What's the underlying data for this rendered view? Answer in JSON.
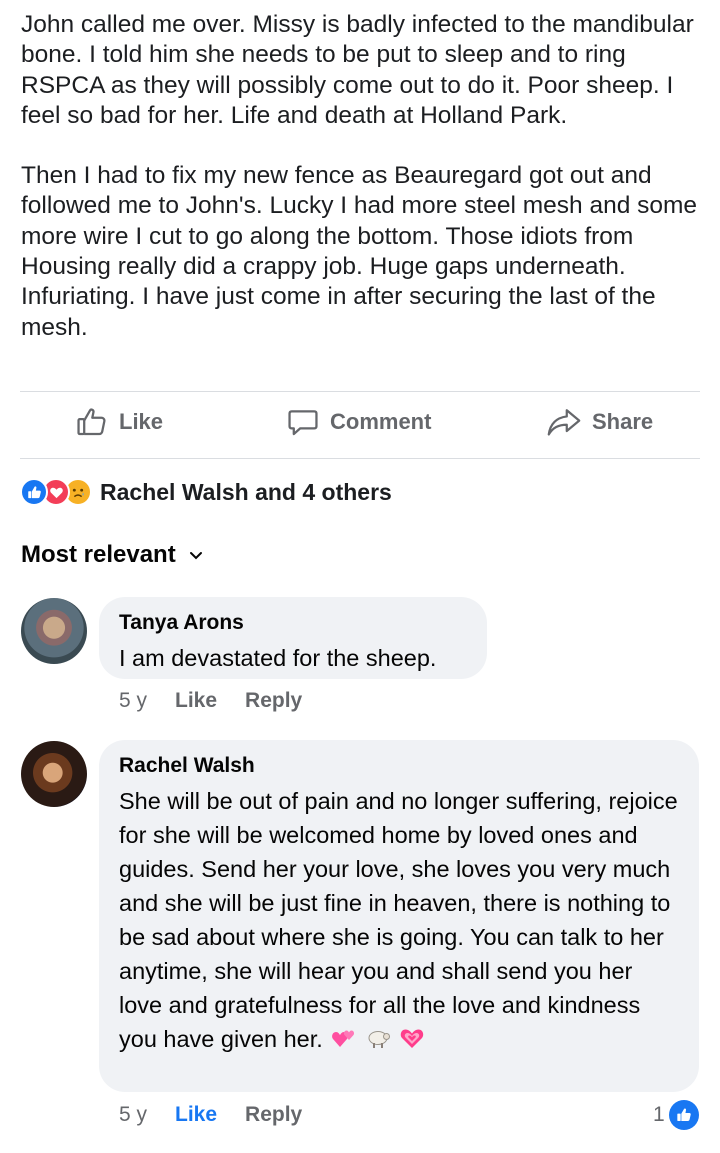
{
  "post": {
    "paragraphs": [
      "John called me over.  Missy is badly infected to the mandibular bone. I told him she needs to be put to sleep and to ring RSPCA as they will possibly come out to do it.  Poor sheep.  I feel so bad for her.  Life and death at Holland Park.",
      "Then I had to fix my new fence as Beauregard got out and followed me to John's.  Lucky I had more steel mesh and some more wire I cut to go along the bottom.  Those idiots from Housing really did a crappy job.  Huge gaps underneath.  Infuriating.  I have just come in after securing the last of the mesh."
    ]
  },
  "actions": {
    "like": "Like",
    "comment": "Comment",
    "share": "Share"
  },
  "reactions": {
    "summary": "Rachel Walsh and 4 others",
    "types": [
      "like",
      "love",
      "sad"
    ]
  },
  "sort": {
    "label": "Most relevant"
  },
  "comments": [
    {
      "author": "Tanya Arons",
      "text": "I am devastated for the sheep.",
      "time": "5 y",
      "like": "Like",
      "reply": "Reply"
    },
    {
      "author": "Rachel Walsh",
      "text": "She will be out of pain and no longer suffering, rejoice for she will be welcomed home by loved ones and guides. Send her your love, she loves you very much and she will be just fine in heaven, there is nothing to be sad about where she is going. You can talk to her anytime, she will hear you and shall send you her love and gratefulness for all the love and kindness you have given her.",
      "emojis": [
        "two-hearts",
        "sheep",
        "growing-heart"
      ],
      "time": "5 y",
      "like": "Like",
      "reply": "Reply",
      "like_count": "1",
      "liked": true
    }
  ],
  "colors": {
    "accent": "#1877f2",
    "secondary_text": "#65676b",
    "bubble": "#f0f2f5"
  }
}
